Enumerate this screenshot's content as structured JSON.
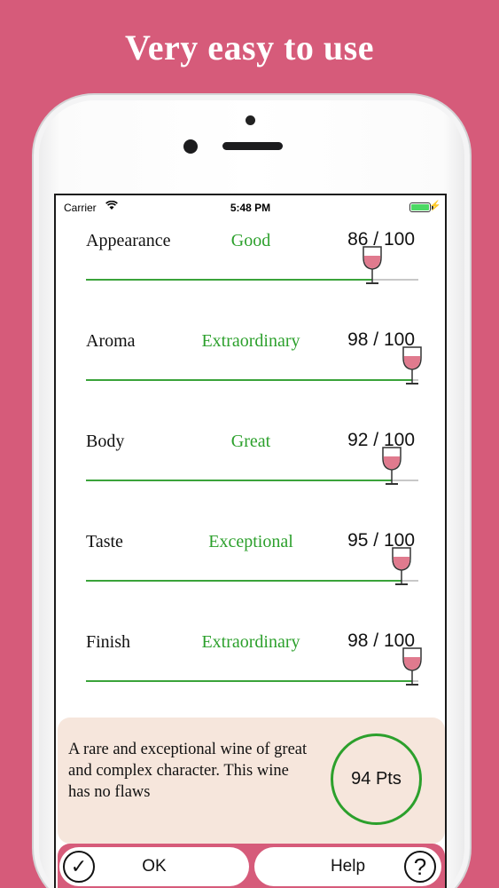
{
  "headline": "Very easy to use",
  "status_bar": {
    "carrier": "Carrier",
    "time": "5:48 PM"
  },
  "categories": [
    {
      "name": "Appearance",
      "rating": "Good",
      "score": "86 / 100",
      "value": 86
    },
    {
      "name": "Aroma",
      "rating": "Extraordinary",
      "score": "98 / 100",
      "value": 98
    },
    {
      "name": "Body",
      "rating": "Great",
      "score": "92 / 100",
      "value": 92
    },
    {
      "name": "Taste",
      "rating": "Exceptional",
      "score": "95 / 100",
      "value": 95
    },
    {
      "name": "Finish",
      "rating": "Extraordinary",
      "score": "98 / 100",
      "value": 98
    }
  ],
  "summary": {
    "text": "A rare and exceptional wine of great and complex character. This wine has no flaws",
    "points": "94 Pts"
  },
  "buttons": {
    "ok": "OK",
    "help": "Help"
  },
  "colors": {
    "background": "#d65b7a",
    "rating_green": "#2ca02c",
    "summary_bg": "#f6e6dc",
    "wine": "#e07a8e"
  },
  "icons": {
    "ok": "checkmark-circle-icon",
    "help": "question-circle-icon",
    "slider_thumb": "wine-glass-icon"
  }
}
